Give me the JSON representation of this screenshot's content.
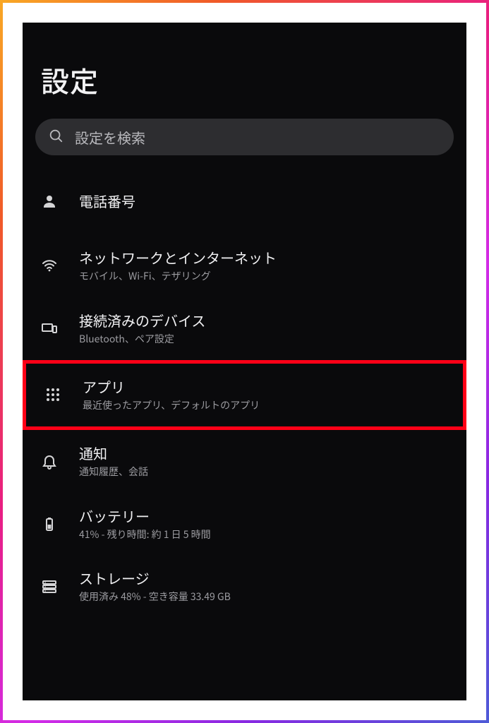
{
  "title": "設定",
  "search": {
    "placeholder": "設定を検索"
  },
  "items": {
    "phone": {
      "label": "電話番号"
    },
    "network": {
      "label": "ネットワークとインターネット",
      "sub": "モバイル、Wi-Fi、テザリング"
    },
    "devices": {
      "label": "接続済みのデバイス",
      "sub": "Bluetooth、ペア設定"
    },
    "apps": {
      "label": "アプリ",
      "sub": "最近使ったアプリ、デフォルトのアプリ"
    },
    "notif": {
      "label": "通知",
      "sub": "通知履歴、会話"
    },
    "battery": {
      "label": "バッテリー",
      "sub": "41% - 残り時間: 約 1 日 5 時間"
    },
    "storage": {
      "label": "ストレージ",
      "sub": "使用済み 48% - 空き容量 33.49 GB"
    }
  }
}
